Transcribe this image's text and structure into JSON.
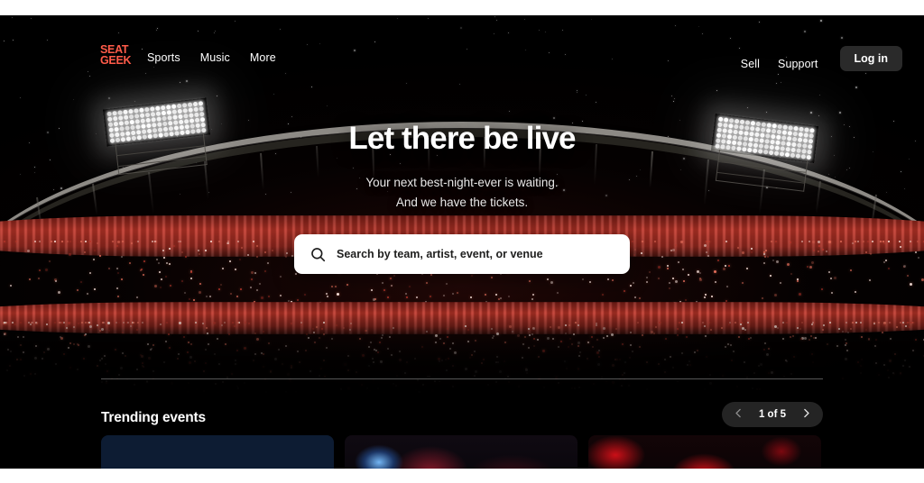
{
  "brand": {
    "name": "SeatGeek",
    "logo_line1": "SEAT",
    "logo_line2": "GEEK",
    "accent_color": "#ff5b49"
  },
  "nav": {
    "left_items": [
      {
        "label": "Sports"
      },
      {
        "label": "Music"
      },
      {
        "label": "More"
      }
    ],
    "right_items": [
      {
        "label": "Sell"
      },
      {
        "label": "Support"
      }
    ],
    "login_label": "Log in"
  },
  "hero": {
    "title": "Let there be live",
    "subtitle_line1": "Your next best-night-ever is waiting.",
    "subtitle_line2": "And we have the tickets."
  },
  "search": {
    "placeholder": "Search by team, artist, event, or venue",
    "value": "",
    "icon": "search-icon"
  },
  "trending": {
    "heading": "Trending events",
    "pager": {
      "label": "1 of 5",
      "current": 1,
      "total": 5,
      "prev_icon": "chevron-left-icon",
      "next_icon": "chevron-right-icon"
    },
    "cards": [
      {
        "id": "card-1",
        "theme": "blue"
      },
      {
        "id": "card-2",
        "theme": "blue-face-red"
      },
      {
        "id": "card-3",
        "theme": "red"
      }
    ]
  },
  "colors": {
    "background": "#000000",
    "page_edge": "#ffffff",
    "text_primary": "#ffffff",
    "text_secondary": "#e8e8e8",
    "button_bg": "#2a2a2a",
    "search_bg": "#ffffff",
    "stadium_band": "#c4372a"
  }
}
